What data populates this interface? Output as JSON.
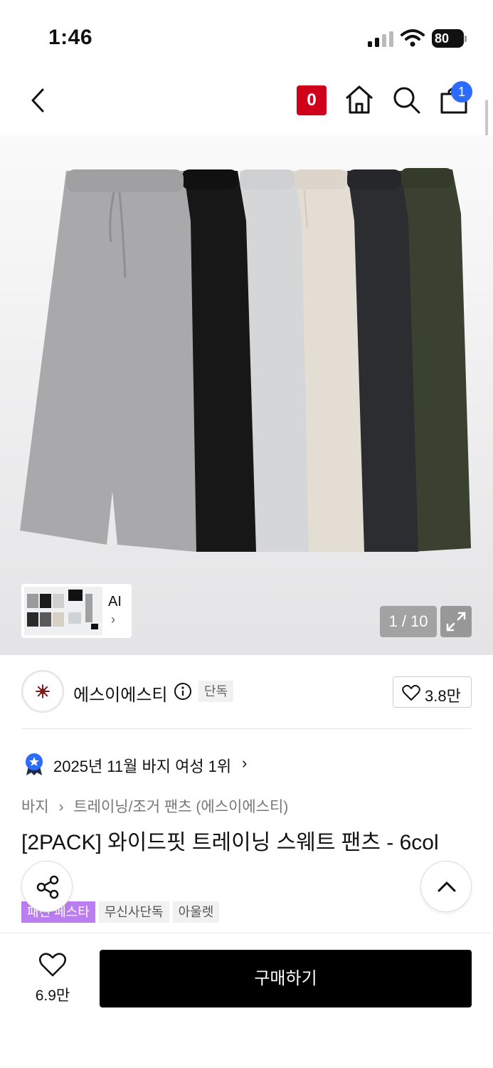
{
  "status_bar": {
    "time": "1:46",
    "battery": "80"
  },
  "header": {
    "back_icon": "chevron-left-icon",
    "points_badge": "0",
    "cart_count": "1"
  },
  "hero": {
    "pager": "1 / 10",
    "thumb_label": "AI",
    "thumb_chevron": "›",
    "pant_colors": [
      "#a9a9ab",
      "#171717",
      "#d5d6d8",
      "#e4ddd4",
      "#2c2d31",
      "#3b4130"
    ]
  },
  "brand": {
    "name": "에스이에스티",
    "tag": "단독",
    "likes": "3.8만"
  },
  "ranking": {
    "text": "2025년 11월 바지 여성 1위",
    "chevron": "›"
  },
  "breadcrumb": {
    "category": "바지",
    "separator": "›",
    "subcategory": "트레이닝/조거 팬츠 (에스이에스티)"
  },
  "product": {
    "title": "[2PACK] 와이드핏 트레이닝 스웨트 팬츠 - 6col",
    "tags": [
      "패션 페스타",
      "무신사단독",
      "아울렛"
    ]
  },
  "bottom_bar": {
    "like_count": "6.9만",
    "buy_label": "구매하기"
  },
  "colors": {
    "accent_red": "#d0021b",
    "badge_blue": "#2b6cff",
    "tag_purple": "#bb7ef0"
  }
}
